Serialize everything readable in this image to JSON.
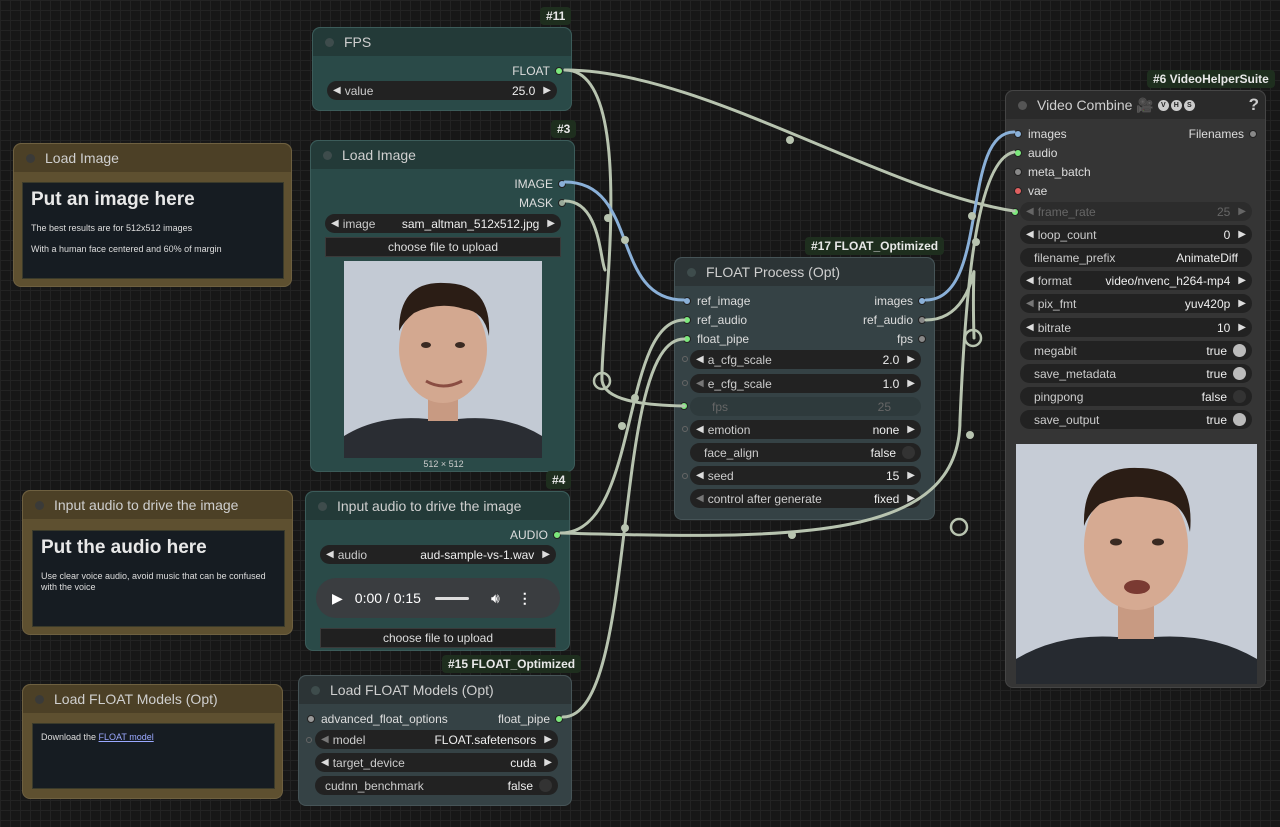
{
  "nodes": {
    "fps": {
      "badge": "#11",
      "title": "FPS",
      "output": "FLOAT",
      "widget_label": "value",
      "widget_value": "25.0"
    },
    "note_image": {
      "title": "Load Image",
      "heading": "Put an image here",
      "line1": "The best results are for 512x512 images",
      "line2": "With a human face centered and 60% of margin"
    },
    "load_image": {
      "badge": "#3",
      "title": "Load Image",
      "out_image": "IMAGE",
      "out_mask": "MASK",
      "widget_label": "image",
      "widget_value": "sam_altman_512x512.jpg",
      "upload": "choose file to upload",
      "dims": "512 × 512"
    },
    "note_audio": {
      "title": "Input audio to drive the image",
      "heading": "Put the audio here",
      "line1": "Use clear voice audio, avoid music that can be confused with the voice"
    },
    "input_audio": {
      "badge": "#4",
      "title": "Input audio to drive the image",
      "output": "AUDIO",
      "widget_label": "audio",
      "widget_value": "aud-sample-vs-1.wav",
      "player_time": "0:00 / 0:15",
      "upload": "choose file to upload"
    },
    "note_models": {
      "title": "Load FLOAT Models (Opt)",
      "text": "Download the ",
      "link": "FLOAT model"
    },
    "load_models": {
      "badge": "#15 FLOAT_Optimized",
      "title": "Load FLOAT Models (Opt)",
      "input": "advanced_float_options",
      "output": "float_pipe",
      "widgets": [
        {
          "label": "model",
          "value": "FLOAT.safetensors"
        },
        {
          "label": "target_device",
          "value": "cuda"
        },
        {
          "label": "cudnn_benchmark",
          "value": "false"
        }
      ]
    },
    "float_process": {
      "badge": "#17 FLOAT_Optimized",
      "title": "FLOAT Process (Opt)",
      "inputs": [
        "ref_image",
        "ref_audio",
        "float_pipe"
      ],
      "outputs": [
        "images",
        "ref_audio",
        "fps"
      ],
      "widgets": [
        {
          "label": "a_cfg_scale",
          "value": "2.0"
        },
        {
          "label": "e_cfg_scale",
          "value": "1.0"
        },
        {
          "label": "fps",
          "value": "25"
        },
        {
          "label": "emotion",
          "value": "none"
        },
        {
          "label": "face_align",
          "value": "false"
        },
        {
          "label": "seed",
          "value": "15"
        },
        {
          "label": "control after generate",
          "value": "fixed"
        }
      ]
    },
    "video_combine": {
      "badge": "#6 VideoHelperSuite",
      "title": "Video Combine 🎥",
      "badges_vhs": [
        "V",
        "H",
        "S"
      ],
      "help": "?",
      "inputs": [
        "images",
        "audio",
        "meta_batch",
        "vae"
      ],
      "output": "Filenames",
      "widgets": [
        {
          "label": "frame_rate",
          "value": "25"
        },
        {
          "label": "loop_count",
          "value": "0"
        },
        {
          "label": "filename_prefix",
          "value": "AnimateDiff"
        },
        {
          "label": "format",
          "value": "video/nvenc_h264-mp4"
        },
        {
          "label": "pix_fmt",
          "value": "yuv420p"
        },
        {
          "label": "bitrate",
          "value": "10"
        },
        {
          "label": "megabit",
          "value": "true"
        },
        {
          "label": "save_metadata",
          "value": "true"
        },
        {
          "label": "pingpong",
          "value": "false"
        },
        {
          "label": "save_output",
          "value": "true"
        }
      ]
    }
  }
}
